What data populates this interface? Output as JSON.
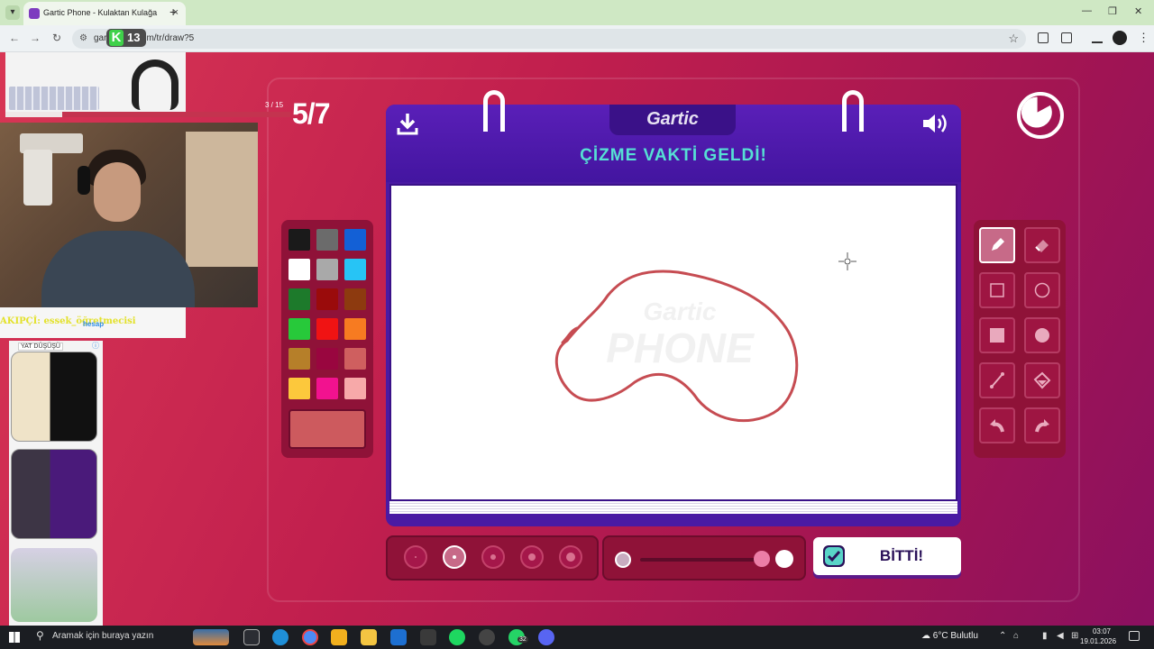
{
  "browser": {
    "tab_title": "Gartic Phone - Kulaktan Kulağa",
    "tab_close": "×",
    "tab_new": "+",
    "url": "gartic.com/tr/draw?5",
    "url_visible_prefix": "gar",
    "url_visible_suffix": "m/tr/draw?5",
    "badge_letter": "K",
    "badge_count": "13",
    "win_min": "—",
    "win_max": "❐",
    "win_close": "✕",
    "back": "←",
    "forward": "→",
    "reload": "↻",
    "star": "☆",
    "kebab": "⋮"
  },
  "game": {
    "round": "5/7",
    "logo": "Gartic",
    "prompt": "ÇİZME VAKTİ GELDİ!",
    "watermark_top": "Gartic",
    "watermark_bottom": "PHONE",
    "done_label": "BİTTİ!",
    "palette": [
      "#1a1a1a",
      "#6b6b6b",
      "#1360d6",
      "#ffffff",
      "#a9a9a9",
      "#27c4f5",
      "#1d7a2b",
      "#9a0b0b",
      "#8d3a0f",
      "#27c93a",
      "#f01313",
      "#f77b21",
      "#b67f29",
      "#99063f",
      "#cf5f5f",
      "#fcc83c",
      "#f2128f",
      "#f7a9a9"
    ],
    "current_color": "#cd5a5e",
    "stroke_color": "#c64c52",
    "tools": [
      "pencil-icon",
      "eraser-icon",
      "rectangle-outline-icon",
      "circle-outline-icon",
      "rectangle-filled-icon",
      "circle-filled-icon",
      "line-icon",
      "fill-bucket-icon",
      "undo-icon",
      "redo-icon"
    ],
    "brush_sizes": 5,
    "brush_size_selected": 2,
    "opacity_level": 0.95
  },
  "stream": {
    "progress": "3 / 15",
    "progress_fraction": 0.2,
    "chat_text": "AKIPÇİ: essek_öğretmecisi",
    "chat_badge": "hesap",
    "ad_label": "YAT DÜŞÜŞÜ",
    "ad_info": "ⓘ"
  },
  "taskbar": {
    "search_placeholder": "Aramak için buraya yazın",
    "weather": "6°C Bulutlu",
    "time": "03:07",
    "date": "19.01.2026",
    "whatsapp_badge": "32"
  }
}
